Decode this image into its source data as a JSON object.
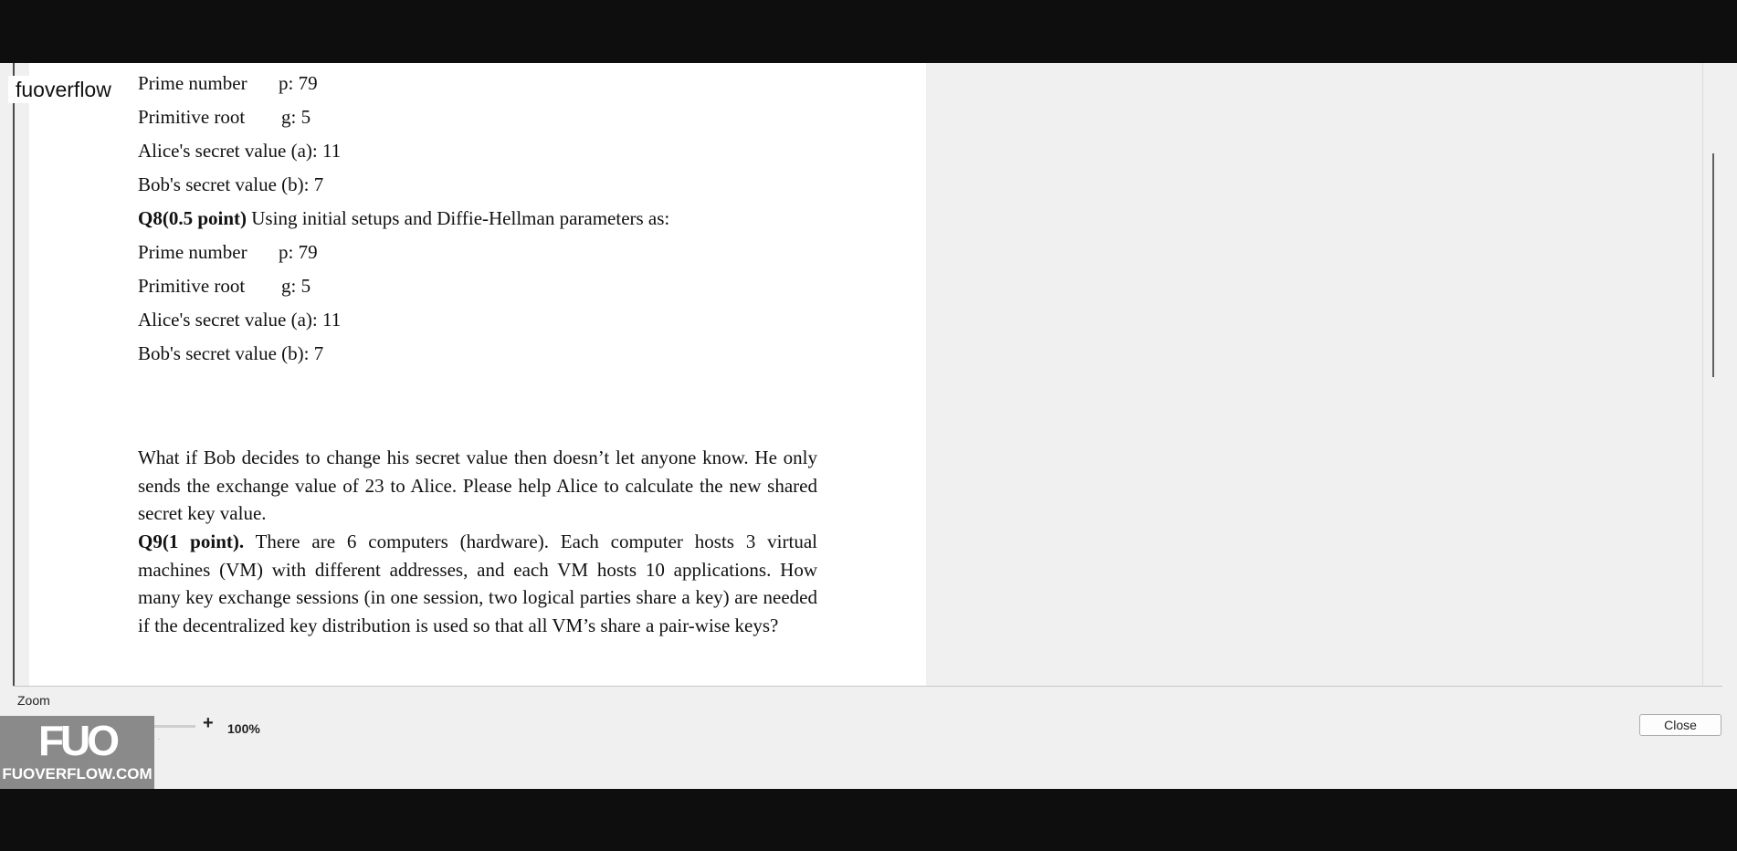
{
  "watermark": {
    "text": "fuoverflow"
  },
  "document": {
    "setup1": {
      "prime": {
        "label": "Prime number",
        "value": "p: 79"
      },
      "root": {
        "label": "Primitive root",
        "value": "g: 5"
      },
      "alice": "Alice's secret value (a): 11",
      "bob": "Bob's secret value (b): 7"
    },
    "q8": {
      "heading": "Q8(0.5 point)",
      "intro": " Using initial setups and Diffie-Hellman parameters as:",
      "prime": {
        "label": "Prime number",
        "value": "p: 79"
      },
      "root": {
        "label": "Primitive root",
        "value": "g: 5"
      },
      "alice": "Alice's secret value (a): 11",
      "bob": "Bob's secret value (b): 7",
      "question": "What if Bob decides to change his secret value then doesn’t let anyone know. He only sends the exchange value of 23 to Alice. Please help Alice to calculate the new shared secret key value."
    },
    "q9": {
      "heading": "Q9(1 point).",
      "text": " There are 6 computers (hardware). Each computer hosts 3 virtual machines (VM) with different addresses, and each VM hosts 10 applications. How many key exchange sessions (in one session, two logical parties share a key) are needed if the decentralized key distribution is used so that all VM’s share a pair-wise keys?"
    }
  },
  "zoom": {
    "label": "Zoom",
    "minus": "-",
    "plus": "+",
    "value": "100%",
    "level_percent": 100
  },
  "close_button": {
    "label": "Close"
  },
  "logo": {
    "mark": "FUO",
    "text": "FUOVERFLOW.COM"
  }
}
